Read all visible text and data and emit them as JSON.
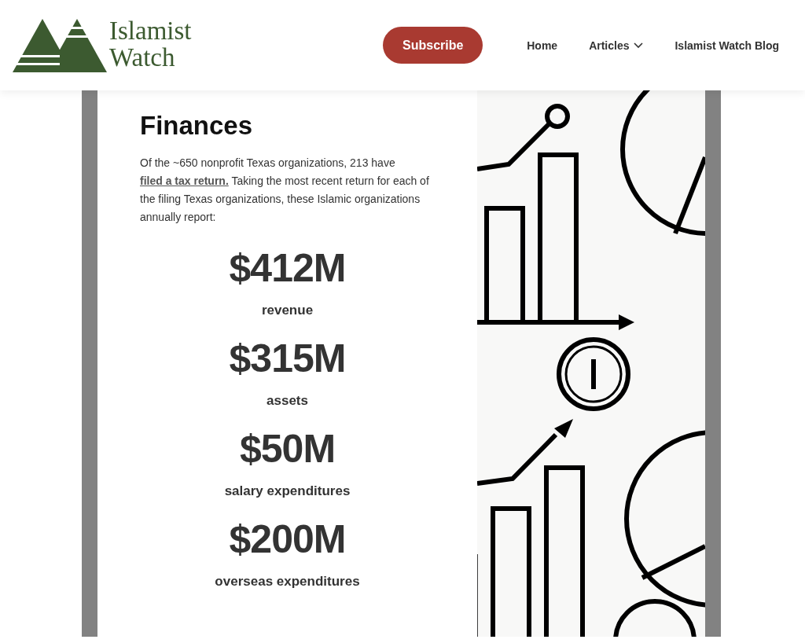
{
  "header": {
    "logo_lines": [
      "Islamist",
      "Watch"
    ],
    "subscribe_button": "Subscribe",
    "nav": [
      {
        "label": "Home",
        "has_dropdown": false
      },
      {
        "label": "Articles",
        "has_dropdown": true
      },
      {
        "label": "Islamist Watch Blog",
        "has_dropdown": false
      }
    ]
  },
  "section": {
    "title": "Finances",
    "intro_before": "Of the ~650 nonprofit Texas organizations, 213 have ",
    "intro_link": "filed a tax return.",
    "intro_after": " Taking the most recent return for each of the filing Texas organizations, these Islamic organizations annually report:",
    "stats": [
      {
        "value": "$412M",
        "label": "revenue"
      },
      {
        "value": "$315M",
        "label": "assets"
      },
      {
        "value": "$50M",
        "label": "salary expenditures"
      },
      {
        "value": "$200M",
        "label": "overseas expenditures"
      }
    ]
  }
}
